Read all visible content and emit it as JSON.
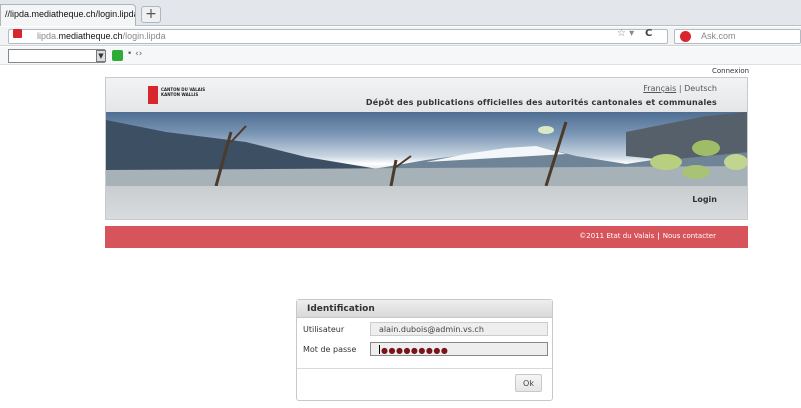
{
  "browser": {
    "tab_title": "//lipda.mediatheque.ch/login.lipda",
    "new_tab": "+",
    "url_prefix": "lipda.",
    "url_domain": "mediatheque.ch",
    "url_path": "/login.lipda",
    "search_engine": "Ask.com",
    "toolbar_more": "• ‹›"
  },
  "page": {
    "connexion": "Connexion",
    "logo_line1": "CANTON DU VALAIS",
    "logo_line2": "KANTON WALLIS",
    "lang_fr": "Français",
    "lang_sep": "|",
    "lang_de": "Deutsch",
    "title": "Dépôt des publications officielles des autorités cantonales et communales",
    "login": "Login",
    "footer_copyright": "©2011 Etat du Valais",
    "footer_sep": "|",
    "footer_contact": "Nous contacter"
  },
  "dialog": {
    "title": "Identification",
    "user_label": "Utilisateur",
    "user_value": "alain.dubois@admin.vs.ch",
    "pass_label": "Mot de passe",
    "pass_value": "●●●●●●●●●",
    "ok": "Ok"
  },
  "colors": {
    "accent_red": "#d7545a",
    "logo_red": "#d7262d"
  }
}
